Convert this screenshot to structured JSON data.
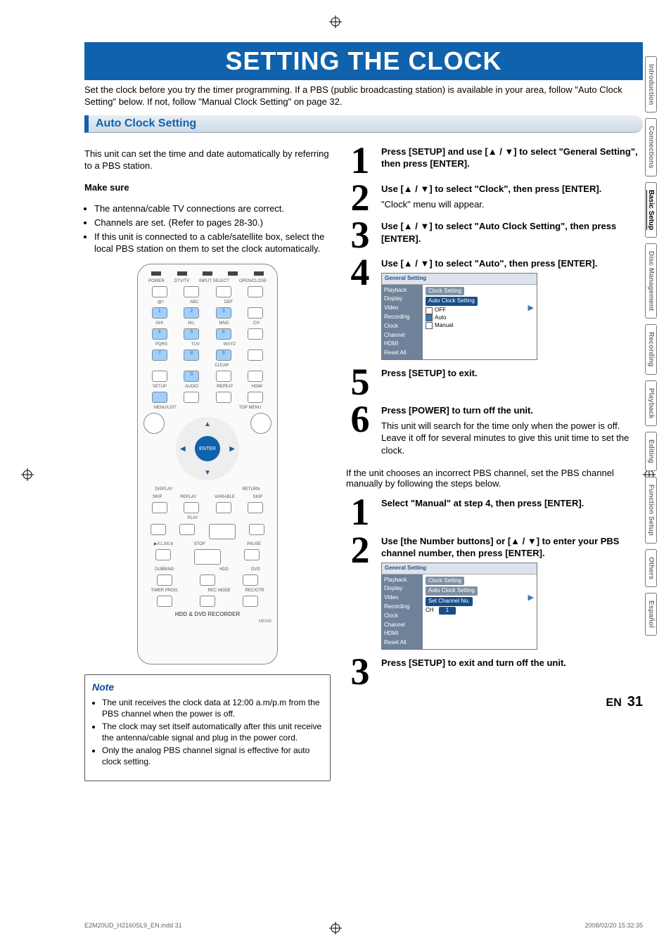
{
  "title": "SETTING THE CLOCK",
  "intro": "Set the clock before you try the timer programming. If a PBS (public broadcasting station) is available in your area, follow \"Auto Clock Setting\" below. If not, follow \"Manual Clock Setting\" on page 32.",
  "section": "Auto Clock Setting",
  "autoIntro": "This unit can set the time and date automatically by referring to a PBS station.",
  "makeSure": "Make sure",
  "bullets": [
    "The antenna/cable TV connections are correct.",
    "Channels are set. (Refer to pages 28-30.)",
    "If this unit is connected to a cable/satellite box, select the local PBS station on them to set the clock automatically."
  ],
  "remote": {
    "labelsTop": [
      "POWER",
      "DTV/TV",
      "INPUT SELECT",
      "OPEN/CLOSE"
    ],
    "numLabels": [
      ".@/:",
      "ABC",
      "DEF",
      "GHI",
      "JKL",
      "MNO",
      "PQRS",
      "TUV",
      "WXYZ"
    ],
    "numbers": [
      "1",
      "2",
      "3",
      "4",
      "5",
      "6",
      "7",
      "8",
      "9",
      "0"
    ],
    "clear": "CLEAR",
    "rowLabels": [
      "SETUP",
      "AUDIO",
      "REPEAT",
      "HDMI"
    ],
    "menuList": "MENU/LIST",
    "topMenu": "TOP MENU",
    "display": "DISPLAY",
    "enter": "ENTER",
    "return": "RETURN",
    "skip": "SKIP",
    "variable": "VARIABLE",
    "replay": "REPLAY",
    "play": "PLAY",
    "stop": "STOP",
    "pause": "PAUSE",
    "speed": "▶X1.3/0.8",
    "dubbing": "DUBBING",
    "hdd": "HDD",
    "dvd": "DVD",
    "timer": "TIMER PROG.",
    "recmode": "REC MODE",
    "recotr": "REC/OTR",
    "model": "HDD & DVD RECORDER",
    "modelNo": "NB345"
  },
  "note": {
    "title": "Note",
    "items": [
      "The unit receives the clock data at 12:00 a.m/p.m from the PBS channel when the power is off.",
      "The clock may set itself automatically after this unit receive the antenna/cable signal and plug in the power cord.",
      "Only the analog PBS channel signal is effective for auto clock setting."
    ]
  },
  "stepsA": [
    {
      "n": "1",
      "bold": "Press [SETUP] and use [▲ / ▼] to select \"General Setting\", then press [ENTER]."
    },
    {
      "n": "2",
      "bold": "Use [▲ / ▼] to select \"Clock\", then press [ENTER].",
      "sub": "\"Clock\" menu will appear."
    },
    {
      "n": "3",
      "bold": "Use [▲ / ▼] to select \"Auto Clock Setting\", then press [ENTER]."
    },
    {
      "n": "4",
      "bold": "Use [▲ / ▼] to select \"Auto\", then press [ENTER]."
    },
    {
      "n": "5",
      "bold": "Press [SETUP] to exit."
    },
    {
      "n": "6",
      "bold": "Press [POWER] to turn off the unit.",
      "sub": "This unit will search for the time only when the power is off. Leave it off for several minutes to give this unit time to set the clock."
    }
  ],
  "between": "If the unit chooses an incorrect PBS channel, set the PBS channel manually by following the steps below.",
  "stepsB": [
    {
      "n": "1",
      "bold": "Select \"Manual\" at step 4, then press [ENTER]."
    },
    {
      "n": "2",
      "bold": "Use [the Number buttons] or [▲ / ▼] to enter your PBS channel number, then press [ENTER]."
    },
    {
      "n": "3",
      "bold": "Press [SETUP] to exit and turn off the unit."
    }
  ],
  "menuA": {
    "title": "General Setting",
    "side": [
      "Playback",
      "Display",
      "Video",
      "Recording",
      "Clock",
      "Channel",
      "HDMI",
      "Reset All"
    ],
    "clockSetting": "Clock Setting",
    "auto": "Auto Clock Setting",
    "opts": [
      "OFF",
      "Auto",
      "Manual"
    ],
    "sel": 1
  },
  "menuB": {
    "title": "General Setting",
    "side": [
      "Playback",
      "Display",
      "Video",
      "Recording",
      "Clock",
      "Channel",
      "HDMI",
      "Reset All"
    ],
    "clockSetting": "Clock Setting",
    "auto": "Auto Clock Setting",
    "setCh": "Set Channel No.",
    "ch": "CH",
    "chVal": "1"
  },
  "tabs": [
    "Introduction",
    "Connections",
    "Basic Setup",
    "Disc Management",
    "Recording",
    "Playback",
    "Editing",
    "Function Setup",
    "Others",
    "Español"
  ],
  "activeTab": 2,
  "footer": {
    "left": "E2M20UD_H2160SL9_EN.indd   31",
    "right": "2008/02/20   15:32:35",
    "en": "EN",
    "page": "31"
  }
}
